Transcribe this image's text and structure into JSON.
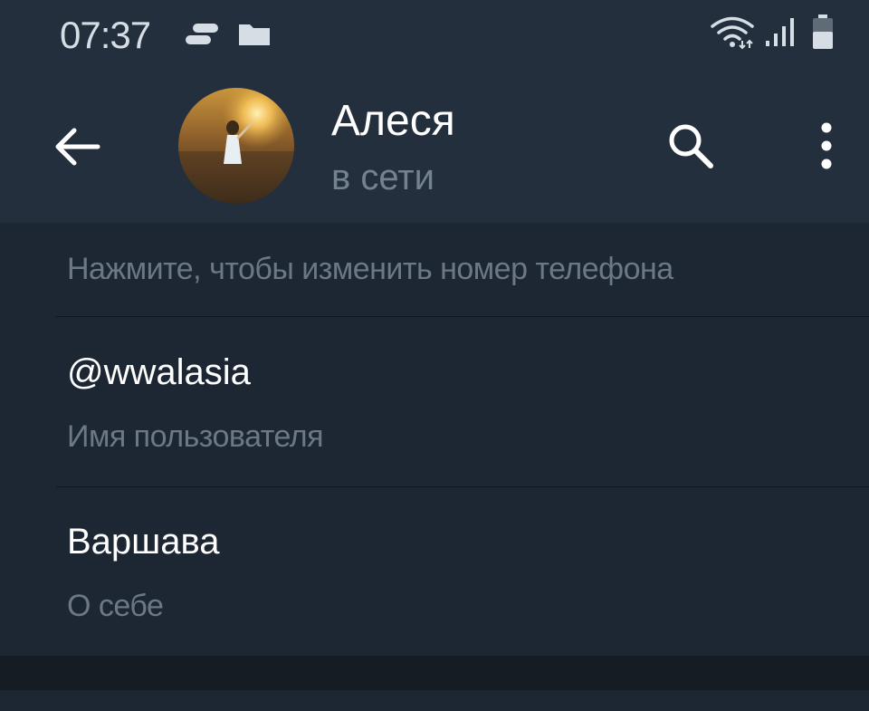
{
  "status_bar": {
    "time": "07:37",
    "icons": [
      "chat-bubble-icon",
      "folder-icon",
      "wifi-icon",
      "signal-icon",
      "battery-icon"
    ]
  },
  "header": {
    "name": "Алеся",
    "status": "в сети",
    "avatar_icon": "avatar-photo",
    "back_icon": "arrow-left-icon",
    "search_icon": "search-icon",
    "menu_icon": "more-vertical-icon"
  },
  "info": {
    "phone_hint": "Нажмите, чтобы изменить номер телефона",
    "username_value": "@wwalasia",
    "username_label": "Имя пользователя",
    "bio_value": "Варшава",
    "bio_label": "О себе"
  },
  "colors": {
    "header_bg": "#242f3d",
    "list_bg": "#1d2733",
    "secondary_text": "#6c7883",
    "primary_text": "#ffffff"
  }
}
